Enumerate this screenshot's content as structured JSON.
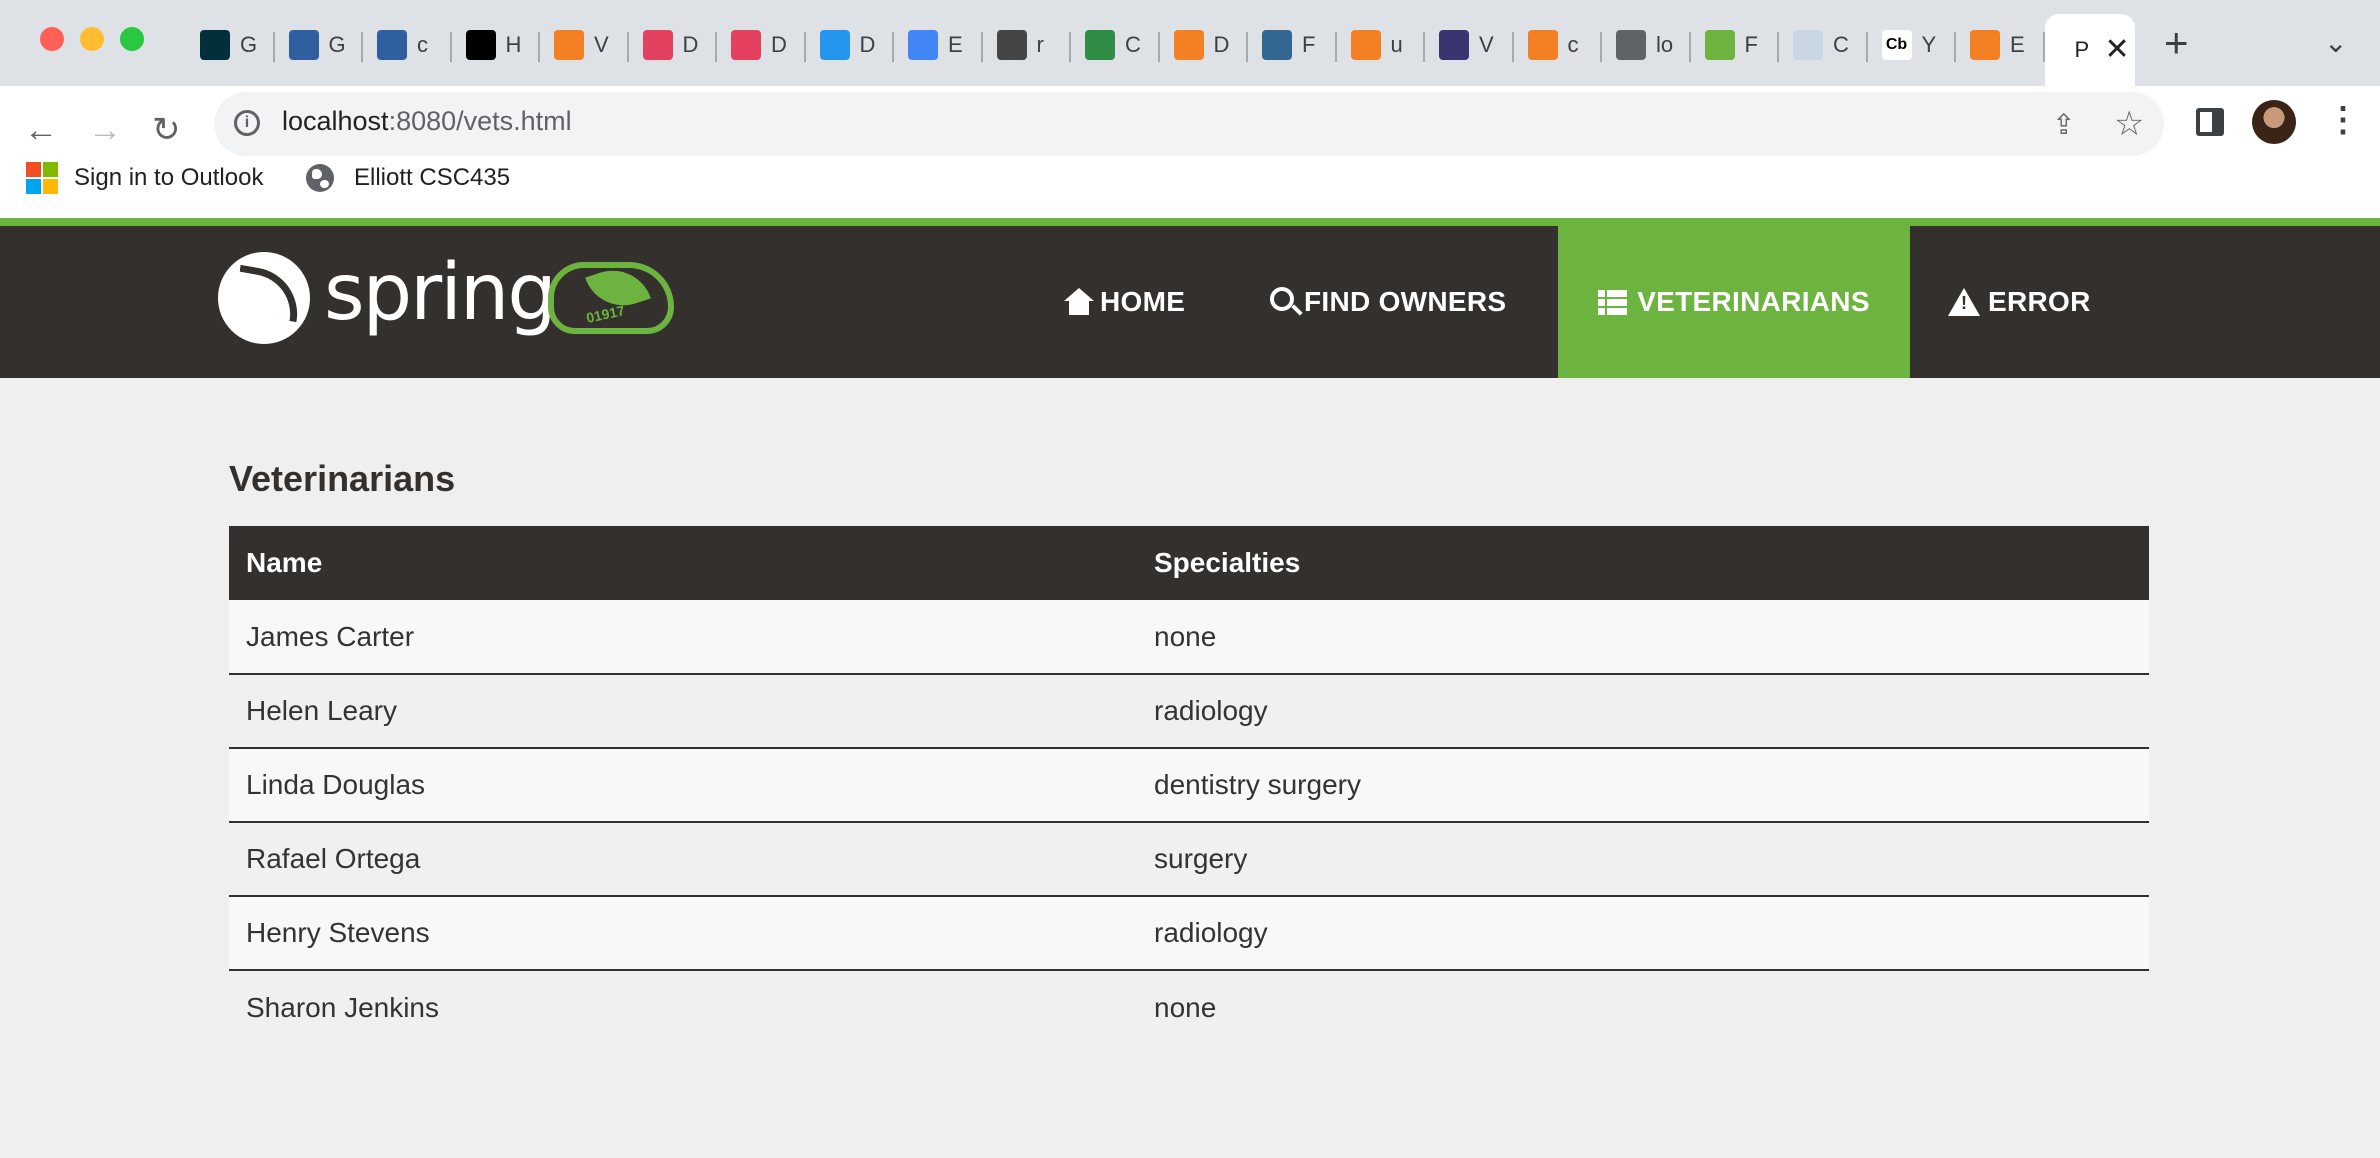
{
  "browser": {
    "tabs": [
      {
        "icon": "gradle-icon",
        "color": "#02303a",
        "title": "G"
      },
      {
        "icon": "shield-icon",
        "color": "#2f5f9e",
        "title": "G"
      },
      {
        "icon": "shield-icon",
        "color": "#2f5f9e",
        "title": "c"
      },
      {
        "icon": "medium-icon",
        "color": "#000000",
        "title": "H"
      },
      {
        "icon": "stackoverflow-icon",
        "color": "#f48024",
        "title": "V"
      },
      {
        "icon": "bootstrap-icon",
        "color": "#e4405f",
        "title": "D"
      },
      {
        "icon": "e-icon",
        "color": "#e4405f",
        "title": "D"
      },
      {
        "icon": "docker-icon",
        "color": "#2496ed",
        "title": "D"
      },
      {
        "icon": "google-icon",
        "color": "#4285f4",
        "title": "E"
      },
      {
        "icon": "grid-icon",
        "color": "#444444",
        "title": "r"
      },
      {
        "icon": "geeksforgeeks-icon",
        "color": "#2f8d46",
        "title": "C"
      },
      {
        "icon": "stackoverflow-icon",
        "color": "#f48024",
        "title": "D"
      },
      {
        "icon": "postgres-icon",
        "color": "#336791",
        "title": "F"
      },
      {
        "icon": "stackoverflow-icon",
        "color": "#f48024",
        "title": "u"
      },
      {
        "icon": "cat-icon",
        "color": "#3a3570",
        "title": "V"
      },
      {
        "icon": "stackoverflow-icon",
        "color": "#f48024",
        "title": "c"
      },
      {
        "icon": "globe-icon",
        "color": "#5f6368",
        "title": "lo"
      },
      {
        "icon": "spring-icon",
        "color": "#6db33f",
        "title": "F"
      },
      {
        "icon": "whale-icon",
        "color": "#c8d7e3",
        "title": "C"
      },
      {
        "icon": "cb-icon",
        "color": "#ffffff",
        "title": "Y",
        "glyph": "Cb"
      },
      {
        "icon": "stackoverflow-icon",
        "color": "#f48024",
        "title": "E"
      }
    ],
    "active_tab": {
      "title": "P"
    },
    "address": {
      "host": "localhost",
      "path": ":8080/vets.html"
    },
    "bookmarks": [
      {
        "label": "Sign in to Outlook"
      },
      {
        "label": "Elliott CSC435"
      }
    ]
  },
  "app": {
    "brand": {
      "word": "spring",
      "cloud_text": "01917"
    },
    "nav": {
      "home": "HOME",
      "find_owners": "FIND OWNERS",
      "veterinarians": "VETERINARIANS",
      "error": "ERROR"
    },
    "active_nav": "veterinarians",
    "accent_color": "#6db33f",
    "nav_bg_color": "#34302d"
  },
  "content": {
    "heading": "Veterinarians",
    "columns": [
      "Name",
      "Specialties"
    ],
    "rows": [
      {
        "name": "James Carter",
        "specialties": "none"
      },
      {
        "name": "Helen Leary",
        "specialties": "radiology"
      },
      {
        "name": "Linda Douglas",
        "specialties": "dentistry surgery"
      },
      {
        "name": "Rafael Ortega",
        "specialties": "surgery"
      },
      {
        "name": "Henry Stevens",
        "specialties": "radiology"
      },
      {
        "name": "Sharon Jenkins",
        "specialties": "none"
      }
    ]
  }
}
